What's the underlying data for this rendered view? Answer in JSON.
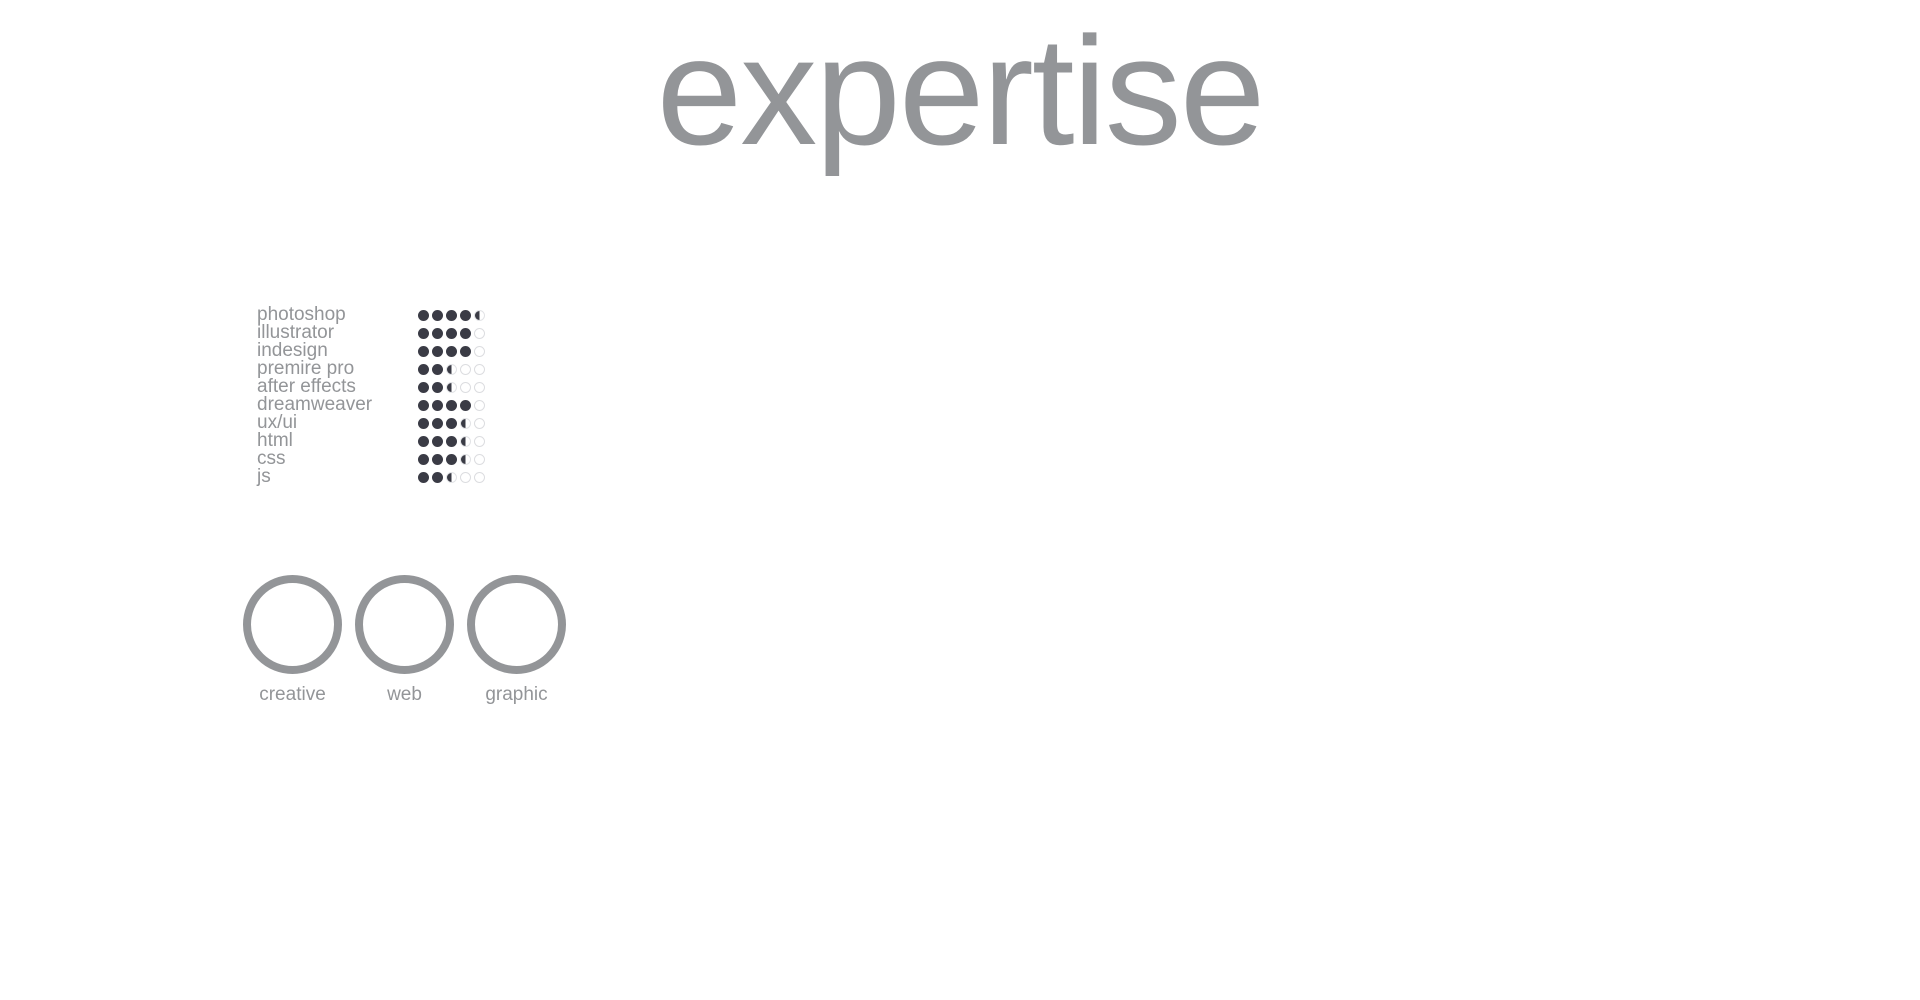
{
  "title": "expertise",
  "skills": [
    {
      "name": "photoshop",
      "level": 4.5
    },
    {
      "name": "illustrator",
      "level": 4
    },
    {
      "name": "indesign",
      "level": 4
    },
    {
      "name": "premire pro",
      "level": 2.5
    },
    {
      "name": "after effects",
      "level": 2.5
    },
    {
      "name": "dreamweaver",
      "level": 4
    },
    {
      "name": "ux/ui",
      "level": 3.5
    },
    {
      "name": "html",
      "level": 3.5
    },
    {
      "name": "css",
      "level": 3.5
    },
    {
      "name": "js",
      "level": 2.5
    }
  ],
  "skill_scale_max": 5,
  "categories": [
    {
      "label": "creative"
    },
    {
      "label": "web"
    },
    {
      "label": "graphic"
    }
  ],
  "colors": {
    "text": "#939598",
    "dot_filled": "#3a3b45",
    "ring": "#939598"
  }
}
